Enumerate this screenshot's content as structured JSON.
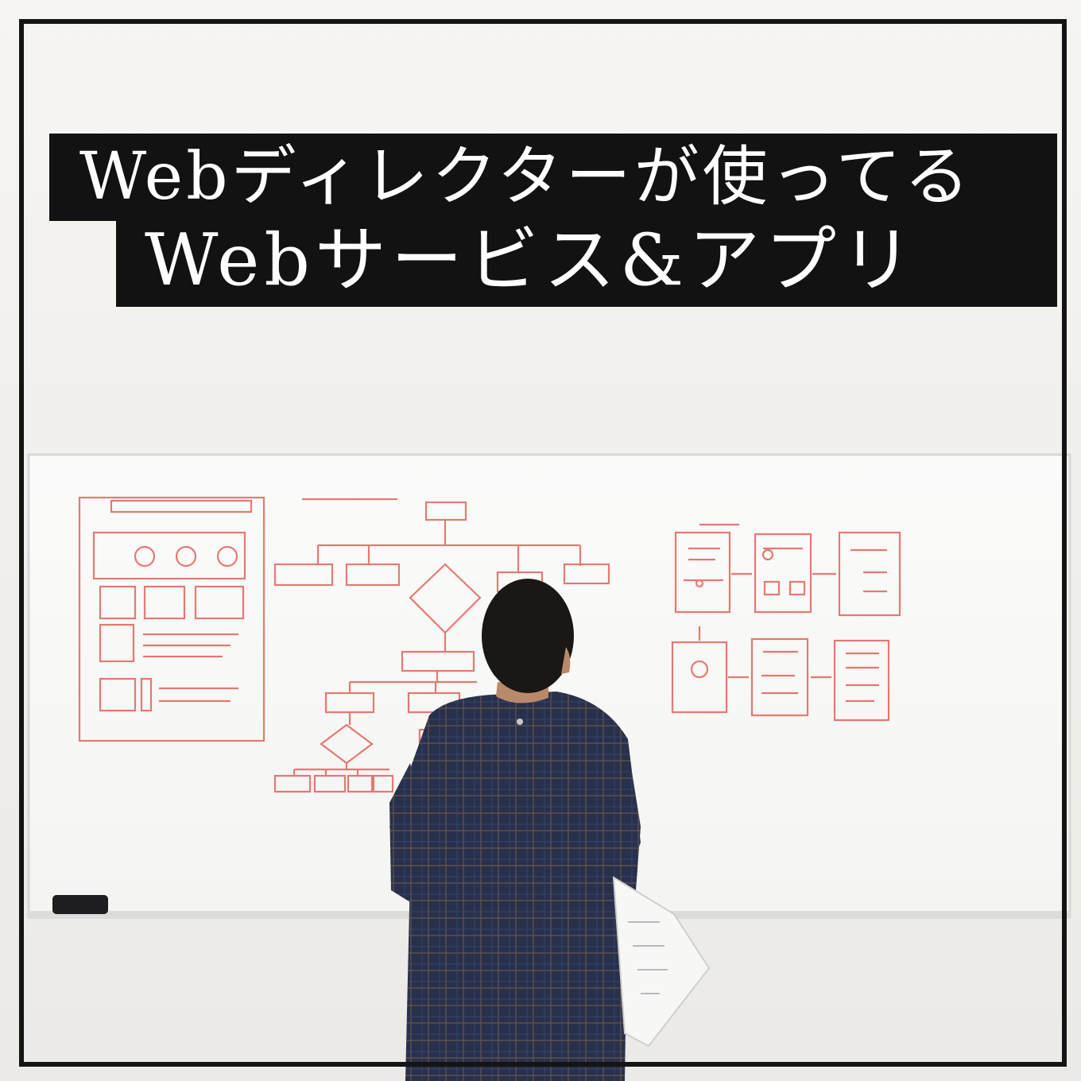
{
  "title": {
    "line1": "Webディレクターが使ってる",
    "line2": "Webサービス&アプリ"
  },
  "colors": {
    "title_band": "#121212",
    "title_text": "#ffffff",
    "frame": "#141414",
    "wall": "#f3f2ef",
    "marker": "#e0645c",
    "shirt": "#2a3350"
  }
}
